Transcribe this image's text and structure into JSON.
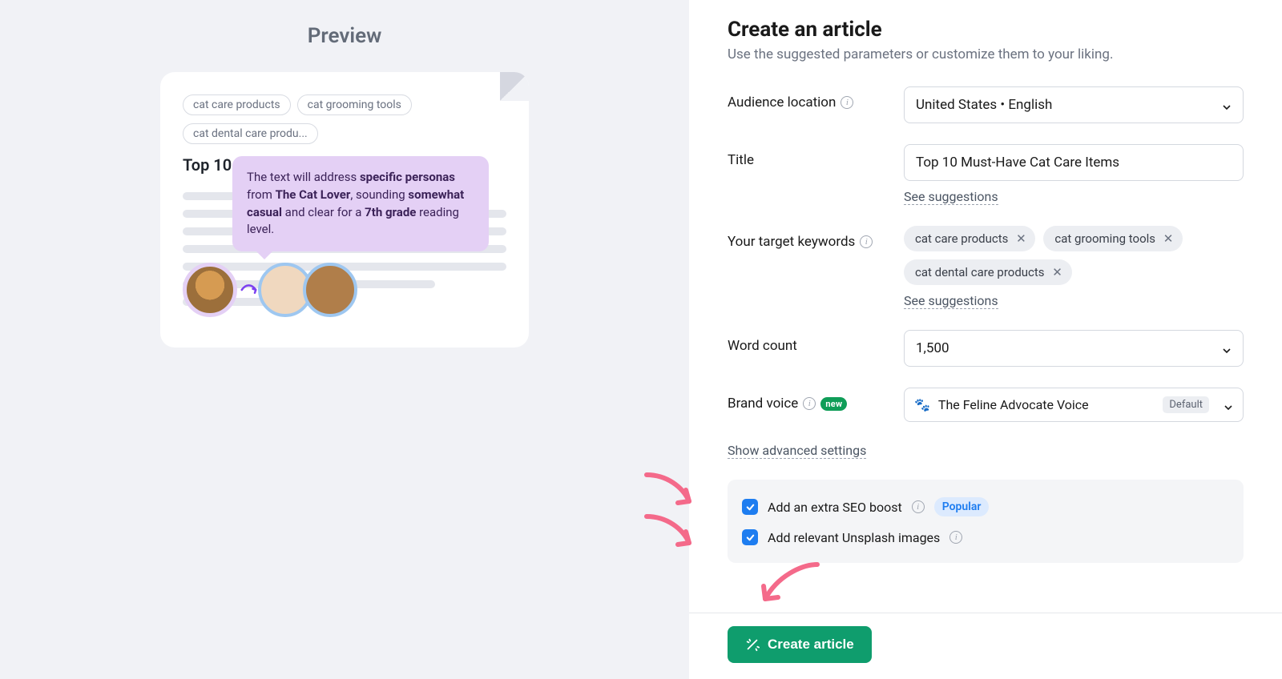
{
  "preview": {
    "heading": "Preview",
    "keywords": [
      "cat care products",
      "cat grooming tools",
      "cat dental care produ..."
    ],
    "title": "Top 10 Must-Have Cat Care Items",
    "tooltip": {
      "prefix": "The text will address ",
      "bold1": "specific personas",
      "mid1": " from ",
      "bold2": "The Cat Lover",
      "mid2": ", sounding ",
      "bold3": "somewhat casual",
      "mid3": " and clear for a ",
      "bold4": "7th grade",
      "suffix": " reading level."
    }
  },
  "form": {
    "title": "Create an article",
    "subtitle": "Use the suggested parameters or customize them to your liking.",
    "audience": {
      "label": "Audience location",
      "value": "United States • English"
    },
    "titleField": {
      "label": "Title",
      "value": "Top 10 Must-Have Cat Care Items",
      "suggestions": "See suggestions"
    },
    "keywordsField": {
      "label": "Your target keywords",
      "tags": [
        "cat care products",
        "cat grooming tools",
        "cat dental care products"
      ],
      "suggestions": "See suggestions"
    },
    "wordCount": {
      "label": "Word count",
      "value": "1,500"
    },
    "brandVoice": {
      "label": "Brand voice",
      "badge": "new",
      "value": "The Feline Advocate Voice",
      "chip": "Default"
    },
    "advanced": "Show advanced settings",
    "seoBoost": {
      "label": "Add an extra SEO boost",
      "badge": "Popular",
      "checked": true
    },
    "unsplash": {
      "label": "Add relevant Unsplash images",
      "checked": true
    },
    "createBtn": "Create article"
  }
}
